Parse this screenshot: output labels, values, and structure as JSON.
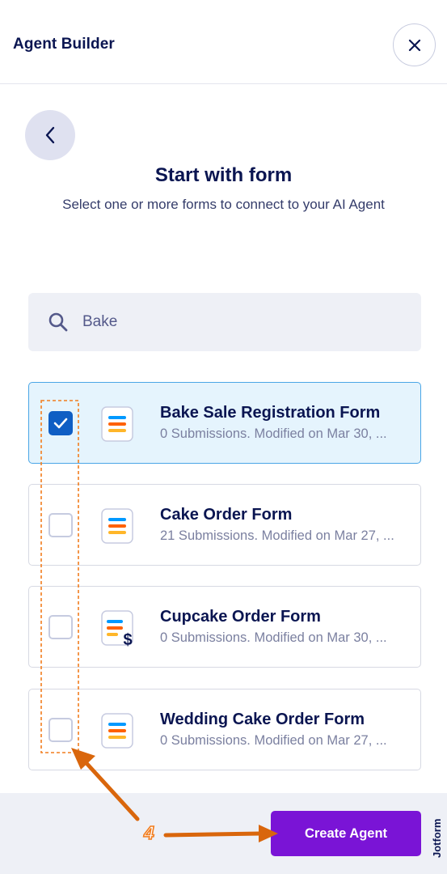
{
  "header": {
    "title": "Agent Builder"
  },
  "page": {
    "title": "Start with form",
    "subtitle": "Select one or more forms to connect to your AI Agent"
  },
  "search": {
    "value": "Bake",
    "icon": "search-icon"
  },
  "forms": [
    {
      "title": "Bake Sale Registration Form",
      "meta": "0 Submissions. Modified on Mar 30, ...",
      "checked": true,
      "icon": "form-icon"
    },
    {
      "title": "Cake Order Form",
      "meta": "21 Submissions. Modified on Mar 27, ...",
      "checked": false,
      "icon": "form-icon"
    },
    {
      "title": "Cupcake Order Form",
      "meta": "0 Submissions. Modified on Mar 30, ...",
      "checked": false,
      "icon": "payment-form-icon"
    },
    {
      "title": "Wedding Cake Order Form",
      "meta": "0 Submissions. Modified on Mar 27, ...",
      "checked": false,
      "icon": "form-icon"
    }
  ],
  "footer": {
    "create_label": "Create Agent",
    "brand": "Jotform"
  },
  "annotation": {
    "step": "4"
  },
  "colors": {
    "accent": "#7a14d6",
    "selected_bg": "#e5f4fd",
    "checkbox_checked": "#0f5ec4",
    "annotation": "#f27d1e"
  }
}
